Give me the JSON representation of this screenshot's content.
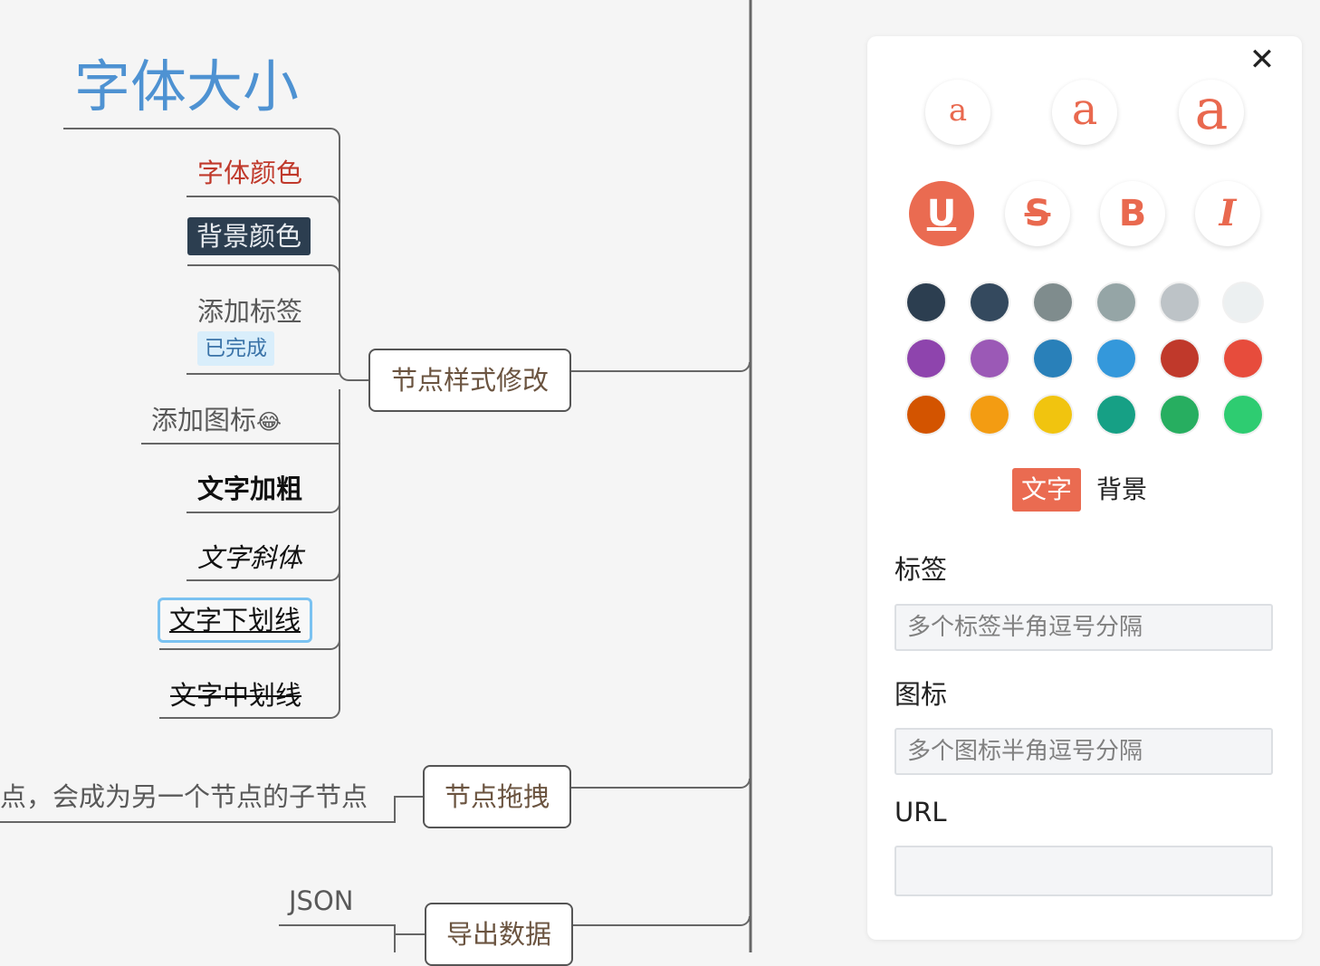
{
  "mindmap": {
    "root_title": "字体大小",
    "leaves": {
      "font_color": "字体颜色",
      "bg_color": "背景颜色",
      "add_tag": "添加标签",
      "tag_done": "已完成",
      "add_icon": "添加图标",
      "icon_emoji": "😂",
      "bold": "文字加粗",
      "italic": "文字斜体",
      "underline": "文字下划线",
      "strike": "文字中划线"
    },
    "drag_child": "点，会成为另一个节点的子节点",
    "json_child": "JSON",
    "branches": {
      "style": "节点样式修改",
      "drag": "节点拖拽",
      "export": "导出数据"
    }
  },
  "panel": {
    "close_glyph": "✕",
    "font_sizes": [
      "a",
      "a",
      "a"
    ],
    "styles": [
      {
        "label": "U",
        "name": "underline",
        "active": true
      },
      {
        "label": "S",
        "name": "strikethrough",
        "active": false
      },
      {
        "label": "B",
        "name": "bold",
        "active": false
      },
      {
        "label": "I",
        "name": "italic",
        "active": false
      }
    ],
    "colors": [
      "#2c3e50",
      "#34495e",
      "#7f8c8d",
      "#95a5a6",
      "#bdc3c7",
      "#ecf0f1",
      "#8e44ad",
      "#9b59b6",
      "#2980b9",
      "#3498db",
      "#c0392b",
      "#e74c3c",
      "#d35400",
      "#f39c12",
      "#f1c40f",
      "#16a085",
      "#27ae60",
      "#2ecc71"
    ],
    "mode_text": "文字",
    "mode_bg": "背景",
    "tag_label": "标签",
    "tag_placeholder": "多个标签半角逗号分隔",
    "icon_label": "图标",
    "icon_placeholder": "多个图标半角逗号分隔",
    "url_label": "URL",
    "url_value": ""
  }
}
